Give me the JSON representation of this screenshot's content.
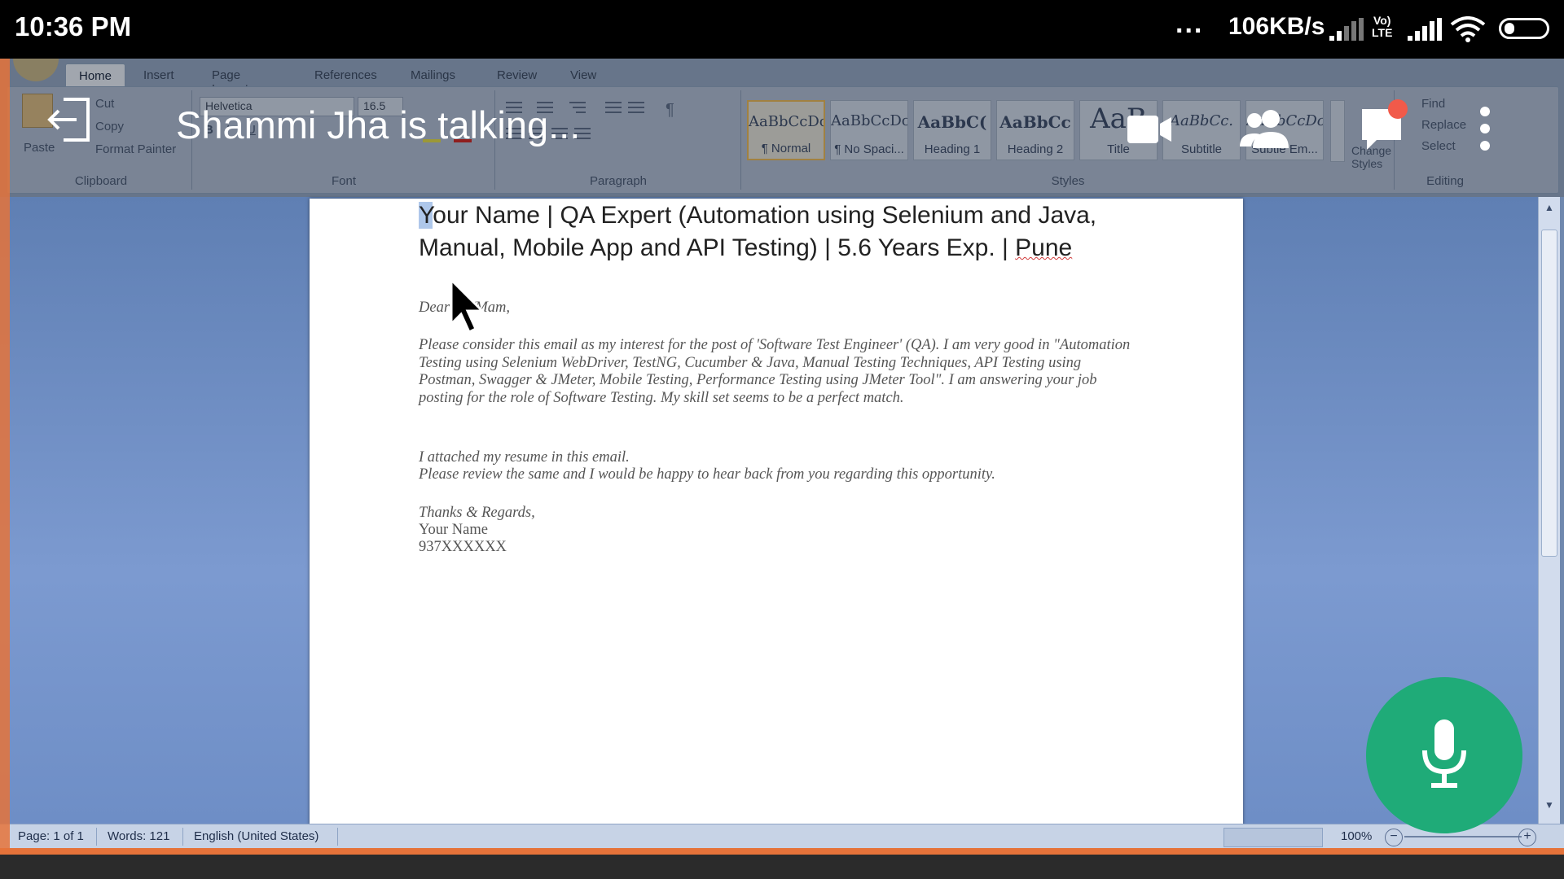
{
  "status_bar": {
    "time": "10:36 PM",
    "dots": "...",
    "speed": "106KB/s",
    "volte": "Vo)\nLTE"
  },
  "word": {
    "tabs": [
      "Home",
      "Insert",
      "Page Layout",
      "References",
      "Mailings",
      "Review",
      "View"
    ],
    "active_tab": "Home",
    "clipboard": {
      "paste": "Paste",
      "cut": "Cut",
      "copy": "Copy",
      "format_painter": "Format Painter",
      "label": "Clipboard"
    },
    "font": {
      "name": "Helvetica",
      "size": "16.5",
      "label": "Font"
    },
    "paragraph": {
      "label": "Paragraph"
    },
    "styles": {
      "label": "Styles",
      "items": [
        {
          "sample": "AaBbCcDc",
          "name": "¶ Normal"
        },
        {
          "sample": "AaBbCcDc",
          "name": "¶ No Spaci..."
        },
        {
          "sample": "AaBbC(",
          "name": "Heading 1"
        },
        {
          "sample": "AaBbCc",
          "name": "Heading 2"
        },
        {
          "sample": "AaB",
          "name": "Title"
        },
        {
          "sample": "AaBbCc.",
          "name": "Subtitle"
        },
        {
          "sample": "AaBbCcDc",
          "name": "Subtle Em..."
        }
      ],
      "change_styles": "Change Styles"
    },
    "editing": {
      "label": "Editing",
      "find": "Find",
      "replace": "Replace",
      "select": "Select"
    },
    "document": {
      "heading_line1_sel": "Y",
      "heading_line1_rest": "our Name | QA Expert (Automation using Selenium and Java,",
      "heading_line2_a": "Manual, Mobile App and API Testing) | 5.6 Years Exp. | ",
      "heading_line2_b": "Pune",
      "greeting": "Dear Sir/Mam,",
      "para1": "Please consider this email as my interest for the post of 'Software Test Engineer' (QA). I am very good in \"Automation Testing using Selenium WebDriver, TestNG, Cucumber & Java, Manual Testing Techniques, API Testing using Postman, Swagger & JMeter, Mobile Testing, Performance Testing using JMeter Tool\". I am answering your job posting for the role of Software Testing. My skill set seems to be a perfect match.",
      "para2a": "I attached my resume in this email.",
      "para2b": "Please review the same and I would be happy to hear back from you regarding this opportunity.",
      "closing": "Thanks & Regards,",
      "name": "Your Name",
      "phone": "937XXXXXX"
    },
    "statusbar": {
      "page": "Page: 1 of 1",
      "words": "Words: 121",
      "language": "English (United States)",
      "zoom": "100%"
    }
  },
  "call_overlay": {
    "talking": "Shammi Jha is talking...",
    "mic_color": "#1fab78"
  }
}
